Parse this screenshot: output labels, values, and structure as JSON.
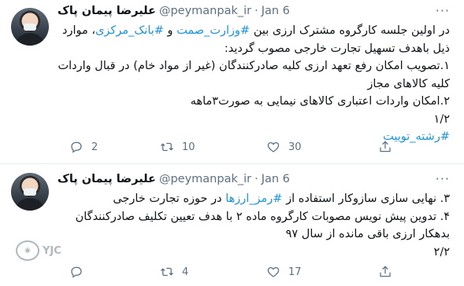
{
  "tweets": [
    {
      "name": "علیرضا پیمان پاک",
      "handle": "@peymanpak_ir",
      "dot": "·",
      "date": "Jan 6",
      "lines": [
        [
          "در اولین جلسه کارگروه مشترک ارزی بین ",
          "#وزارت_صمت",
          " و ",
          "#بانک_مرکزی",
          "، موارد"
        ],
        [
          "ذیل باهدف تسهیل تجارت خارجی مصوب گردید:"
        ],
        [
          "۱.تصویب امکان رفع تعهد ارزی کلیه صادرکنندگان (غیر از مواد خام) در قبال واردات"
        ],
        [
          "کلیه کالاهای مجاز"
        ],
        [
          "۲.امکان واردات اعتباری کالاهای نیمایی به صورت۳ماهه"
        ],
        [
          "۱/۲"
        ],
        [
          "",
          "#رشته_توییت",
          ""
        ]
      ],
      "reply_count": "2",
      "retweet_count": "10",
      "like_count": "30"
    },
    {
      "name": "علیرضا پیمان پاک",
      "handle": "@peymanpak_ir",
      "dot": "·",
      "date": "Jan 6",
      "lines": [
        [
          "۳. نهایی سازی سازوکار استفاده از ",
          "#رمز_ارزها",
          " در حوزه تجارت خارجی"
        ],
        [
          "۴. تدوین پیش نویس مصوبات کارگروه ماده ۲ با هدف تعیین تکلیف صادرکنندگان"
        ],
        [
          "بدهکار ارزی باقی مانده از سال ۹۷"
        ],
        [
          "۲/۲"
        ]
      ],
      "reply_count": "",
      "retweet_count": "4",
      "like_count": "17"
    }
  ],
  "more_label": "···",
  "watermark": "YJC",
  "icons": {
    "reply": "reply-icon",
    "retweet": "retweet-icon",
    "like": "heart-icon",
    "share": "share-icon"
  },
  "colors": {
    "hashtag": "#1b95e0",
    "secondary_text": "#5b7083",
    "divider": "#e6ecf0"
  }
}
